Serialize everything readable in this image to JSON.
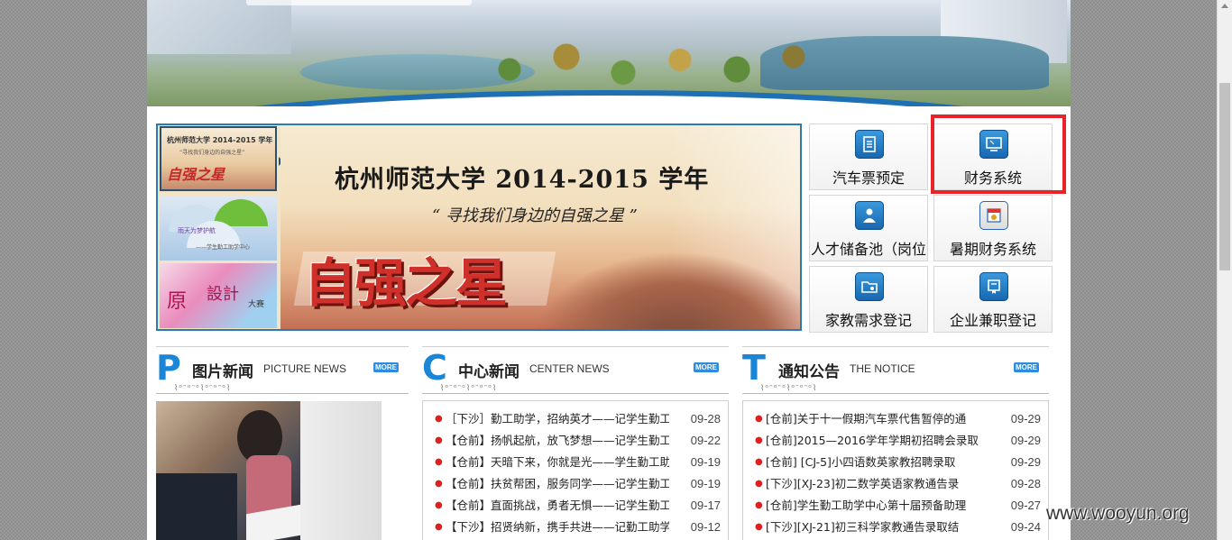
{
  "slideshow": {
    "main_title": "杭州师范大学 2014-2015 学年",
    "main_subtitle": "“ 寻找我们身边的自强之星 ”",
    "main_logo_text": "自强之星",
    "thumbs": [
      {
        "line1": "杭州师范大学 2014-2015 学年",
        "line2": "“寻找我们身边的自强之星”",
        "logo": "自强之星"
      },
      {
        "line1": "雨天为梦护航",
        "line2": "——学生勤工助学中心"
      },
      {
        "line1": "原",
        "line2": "設計",
        "line3": "大赛"
      }
    ]
  },
  "quick_links": [
    {
      "label": "汽车票预定",
      "icon": "document-icon"
    },
    {
      "label": "财务系统",
      "icon": "monitor-icon"
    },
    {
      "label": "人才储备池（岗位",
      "icon": "person-icon"
    },
    {
      "label": "暑期财务系统",
      "icon": "calendar-icon"
    },
    {
      "label": "家教需求登记",
      "icon": "folder-icon"
    },
    {
      "label": "企业兼职登记",
      "icon": "certificate-icon"
    }
  ],
  "sections": {
    "picture_news": {
      "letter": "P",
      "title": "图片新闻",
      "en": "PICTURE NEWS",
      "more": "MORE"
    },
    "center_news": {
      "letter": "C",
      "title": "中心新闻",
      "en": "CENTER NEWS",
      "more": "MORE"
    },
    "notice": {
      "letter": "T",
      "title": "通知公告",
      "en": "THE NOTICE",
      "more": "MORE"
    }
  },
  "center_news_items": [
    {
      "title": "［下沙］勤工助学，招纳英才——记学生勤工",
      "date": "09-28"
    },
    {
      "title": "【仓前】扬帆起航，放飞梦想——记学生勤工",
      "date": "09-22"
    },
    {
      "title": "【仓前】天暗下来，你就是光——学生勤工助",
      "date": "09-19"
    },
    {
      "title": "【仓前】扶贫帮困，服务同学——记学生勤工",
      "date": "09-19"
    },
    {
      "title": "【仓前】直面挑战，勇者无惧——记学生勤工",
      "date": "09-17"
    },
    {
      "title": "【下沙】招贤纳新，携手共进——记勤工助学",
      "date": "09-12"
    }
  ],
  "notice_items": [
    {
      "title": "[仓前]关于十一假期汽车票代售暂停的通",
      "date": "09-29"
    },
    {
      "title": "[仓前]2015—2016学年学期初招聘会录取",
      "date": "09-29"
    },
    {
      "title": "[仓前] [CJ-5]小四语数英家教招聘录取",
      "date": "09-29"
    },
    {
      "title": "[下沙][XJ-23]初二数学英语家教通告录",
      "date": "09-28"
    },
    {
      "title": "[仓前]学生勤工助学中心第十届预备助理",
      "date": "09-27"
    },
    {
      "title": "[下沙][XJ-21]初三科学家教通告录取结",
      "date": "09-24"
    }
  ],
  "watermark": "www.wooyun.org",
  "colors": {
    "accent": "#1c86d6",
    "highlight": "#e8232a",
    "bullet": "#e02020"
  }
}
